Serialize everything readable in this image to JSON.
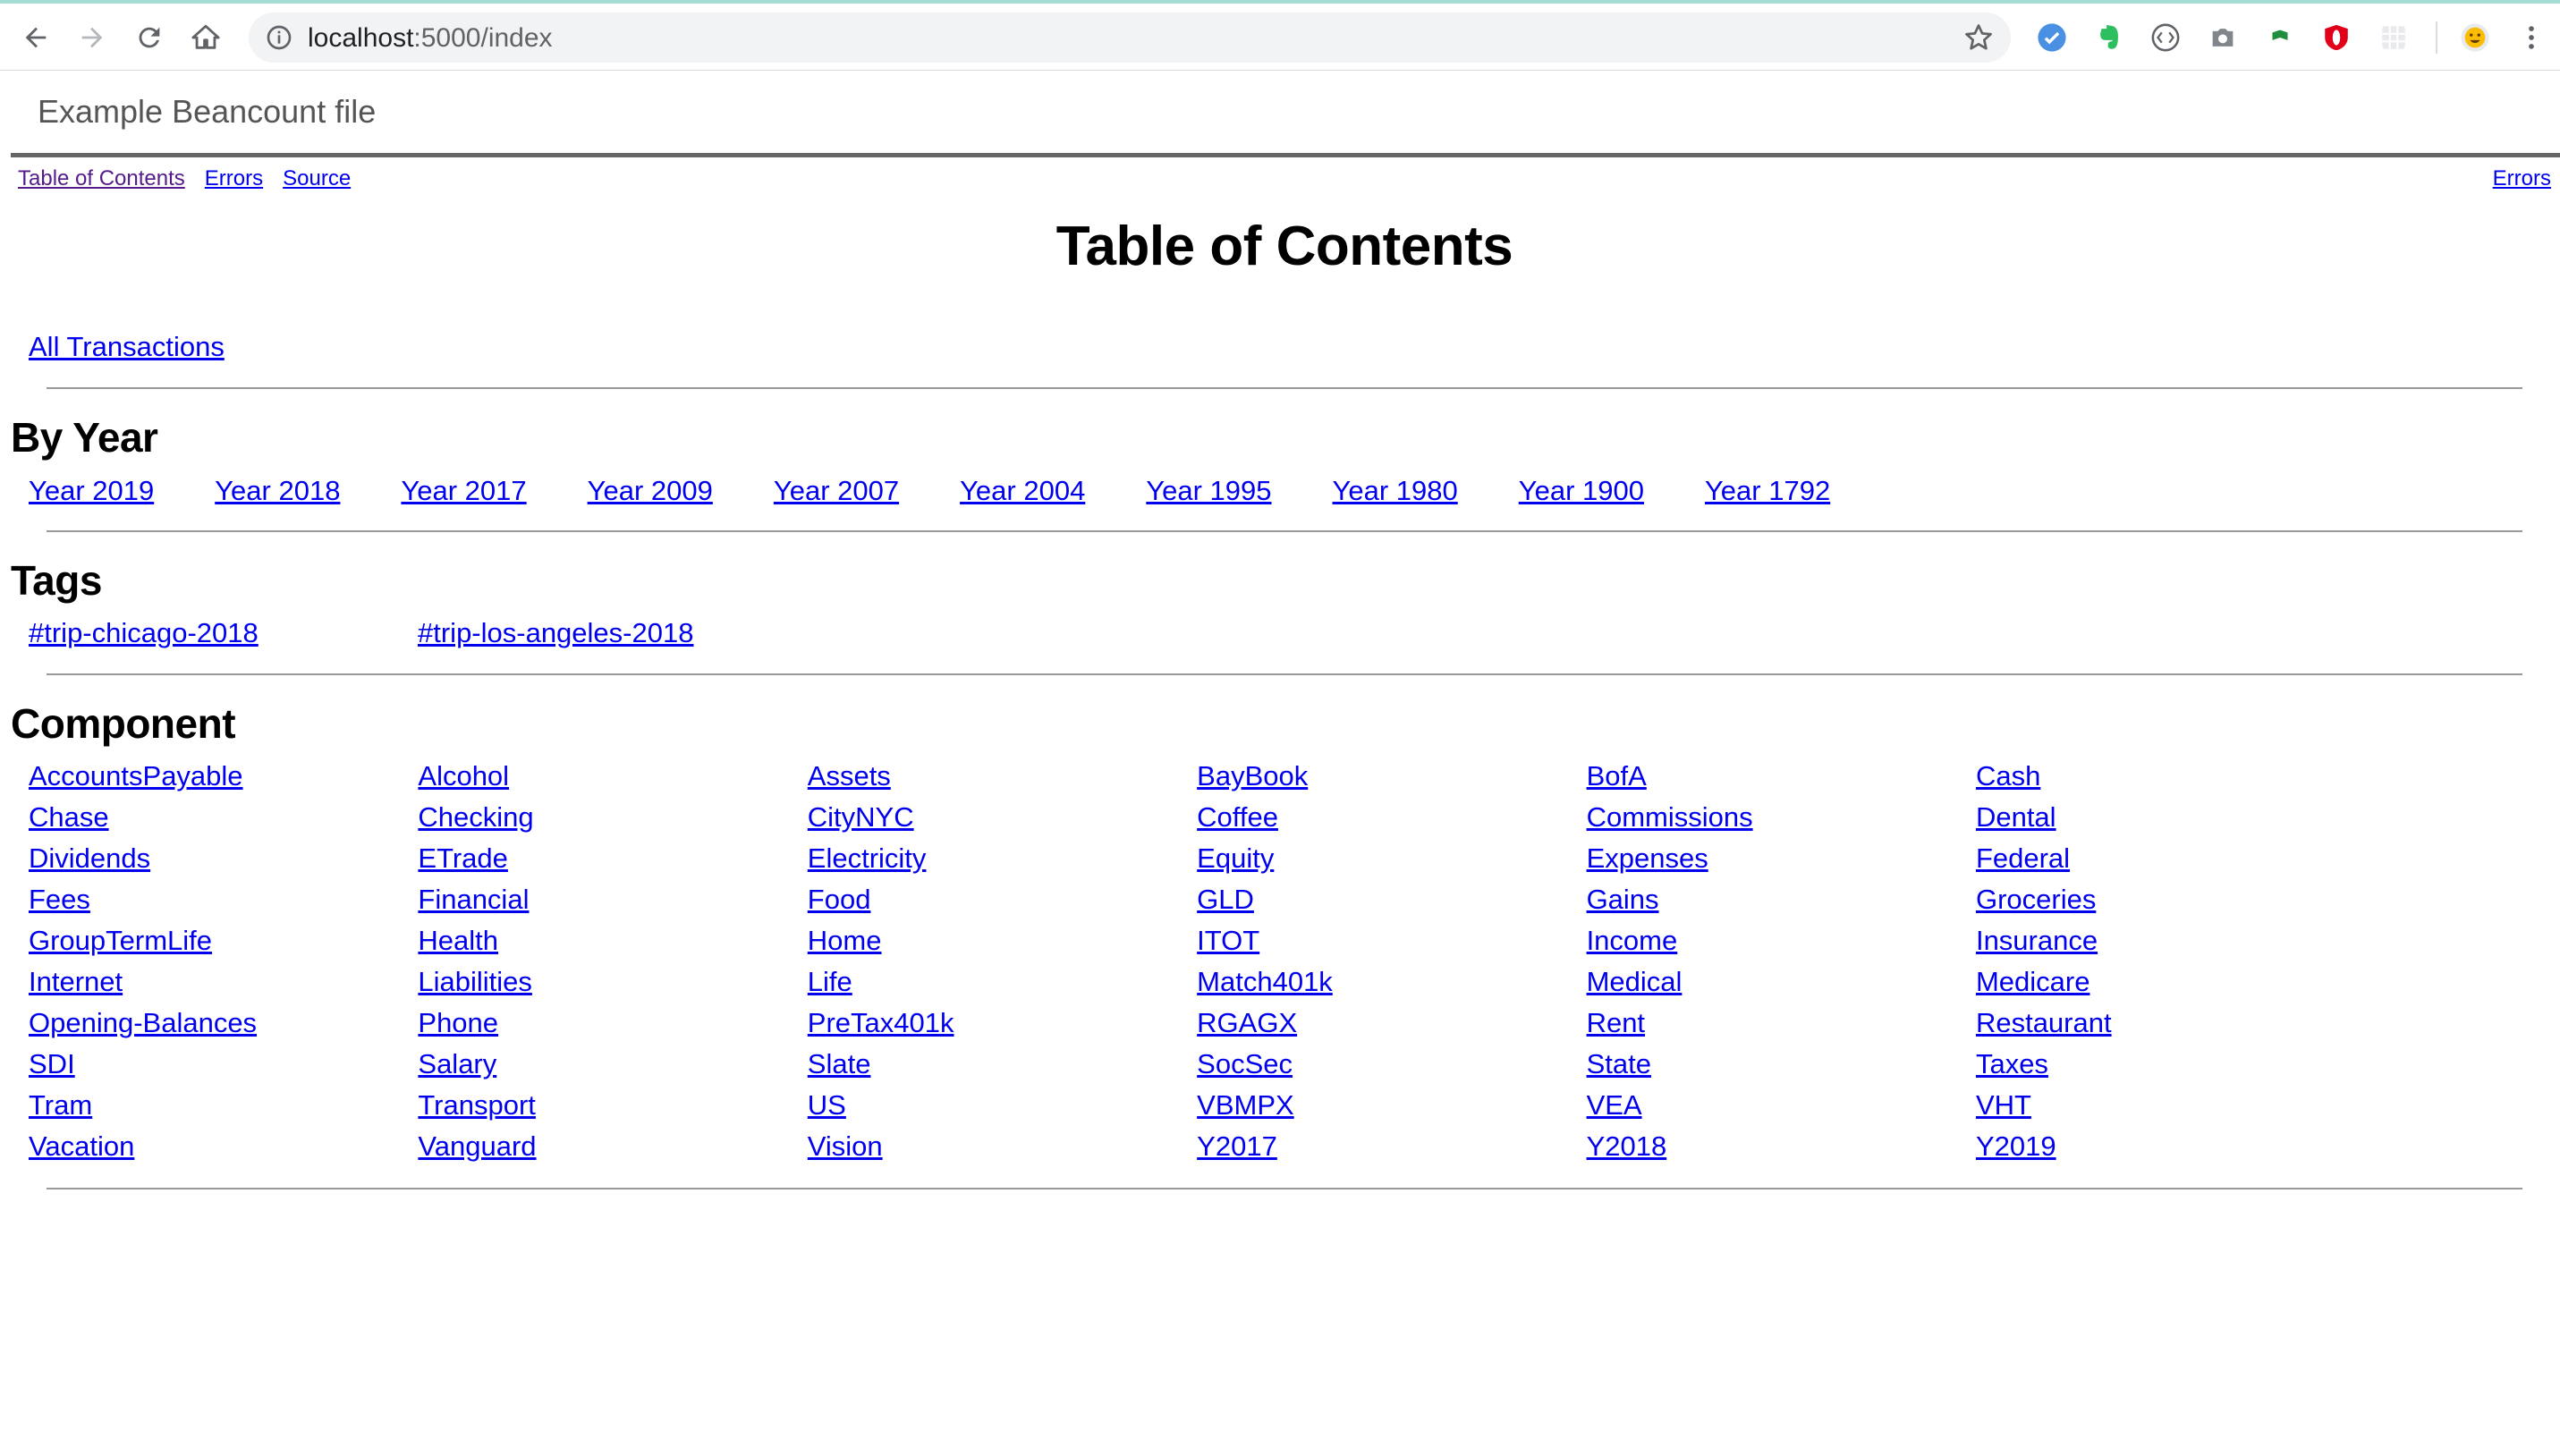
{
  "browser": {
    "url_host": "localhost",
    "url_path": ":5000/index"
  },
  "site_title": "Example Beancount file",
  "topnav": {
    "left": [
      "Table of Contents",
      "Errors",
      "Source"
    ],
    "right": "Errors"
  },
  "page_title": "Table of Contents",
  "all_transactions": "All Transactions",
  "sections": {
    "by_year": "By Year",
    "tags": "Tags",
    "component": "Component"
  },
  "years": [
    "Year 2019",
    "Year 2018",
    "Year 2017",
    "Year 2009",
    "Year 2007",
    "Year 2004",
    "Year 1995",
    "Year 1980",
    "Year 1900",
    "Year 1792"
  ],
  "tags": [
    "#trip-chicago-2018",
    "#trip-los-angeles-2018"
  ],
  "components": [
    "AccountsPayable",
    "Alcohol",
    "Assets",
    "BayBook",
    "BofA",
    "Cash",
    "Chase",
    "Checking",
    "CityNYC",
    "Coffee",
    "Commissions",
    "Dental",
    "Dividends",
    "ETrade",
    "Electricity",
    "Equity",
    "Expenses",
    "Federal",
    "Fees",
    "Financial",
    "Food",
    "GLD",
    "Gains",
    "Groceries",
    "GroupTermLife",
    "Health",
    "Home",
    "ITOT",
    "Income",
    "Insurance",
    "Internet",
    "Liabilities",
    "Life",
    "Match401k",
    "Medical",
    "Medicare",
    "Opening-Balances",
    "Phone",
    "PreTax401k",
    "RGAGX",
    "Rent",
    "Restaurant",
    "SDI",
    "Salary",
    "Slate",
    "SocSec",
    "State",
    "Taxes",
    "Tram",
    "Transport",
    "US",
    "VBMPX",
    "VEA",
    "VHT",
    "Vacation",
    "Vanguard",
    "Vision",
    "Y2017",
    "Y2018",
    "Y2019"
  ]
}
